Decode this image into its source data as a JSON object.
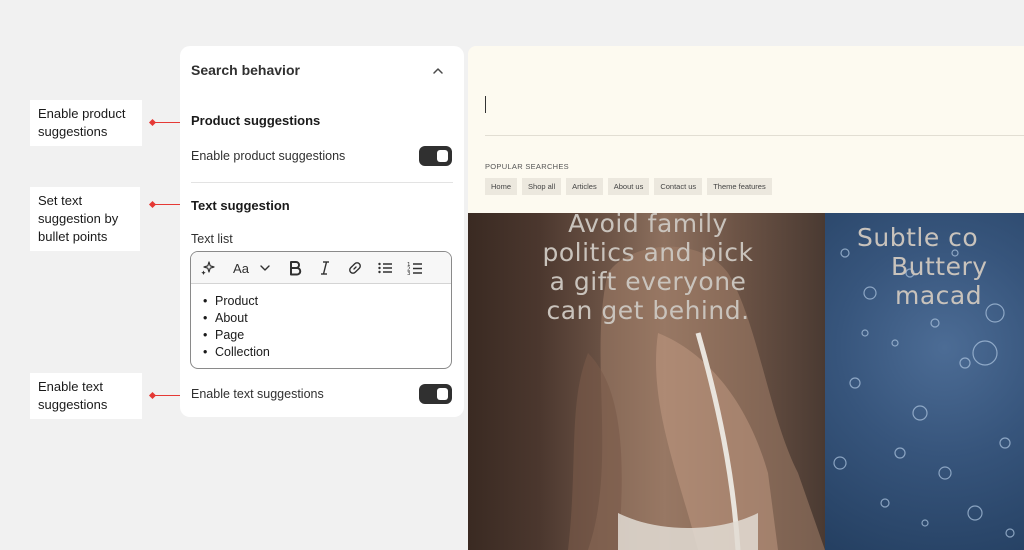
{
  "annotations": {
    "product": "Enable product suggestions",
    "text_bullets": "Set text suggestion by bullet points",
    "text_enable": "Enable text suggestions"
  },
  "panel": {
    "title": "Search behavior",
    "product_section": {
      "title": "Product suggestions",
      "toggle_label": "Enable product suggestions",
      "toggle_on": true
    },
    "text_section": {
      "title": "Text suggestion",
      "list_label": "Text list",
      "list_items": [
        "Product",
        "About",
        "Page",
        "Collection"
      ],
      "toggle_label": "Enable text suggestions",
      "toggle_on": true
    },
    "toolbar": {
      "font_label": "Aa"
    }
  },
  "preview": {
    "popular_title": "POPULAR SEARCHES",
    "chips": [
      "Home",
      "Shop all",
      "Articles",
      "About us",
      "Contact us",
      "Theme features"
    ],
    "hero_left_lines": [
      "Avoid family",
      "politics and pick",
      "a gift everyone",
      "can get behind."
    ],
    "hero_right_lines": [
      "Subtle co",
      "Buttery",
      "macad"
    ]
  },
  "colors": {
    "annotation_arrow": "#e53935",
    "toggle_on": "#303030",
    "preview_background": "#fdfaf0"
  }
}
